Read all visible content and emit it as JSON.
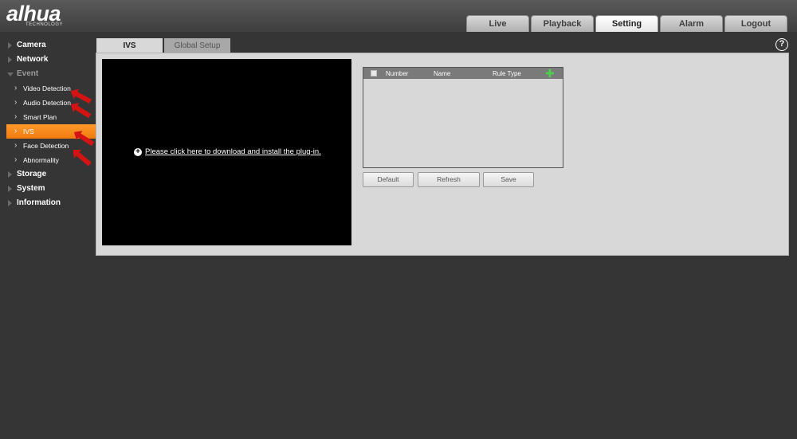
{
  "brand": {
    "logo_text": "alhua",
    "logo_sub": "TECHNOLOGY"
  },
  "nav": {
    "tabs": [
      {
        "label": "Live",
        "active": false
      },
      {
        "label": "Playback",
        "active": false
      },
      {
        "label": "Setting",
        "active": true
      },
      {
        "label": "Alarm",
        "active": false
      },
      {
        "label": "Logout",
        "active": false
      }
    ]
  },
  "sidebar": {
    "camera": "Camera",
    "network": "Network",
    "event": "Event",
    "event_items": [
      "Video Detection",
      "Audio Detection",
      "Smart Plan",
      "IVS",
      "Face Detection",
      "Abnormality"
    ],
    "active_item": "IVS",
    "storage": "Storage",
    "system": "System",
    "information": "Information"
  },
  "content": {
    "tabs": [
      "IVS",
      "Global Setup"
    ],
    "active_tab": "IVS",
    "help_glyph": "?",
    "plugin_message": "Please click here to download and install the plug-in.",
    "rule_table": {
      "columns": [
        "Number",
        "Name",
        "Rule Type"
      ],
      "rows": []
    },
    "buttons": {
      "default": "Default",
      "refresh": "Refresh",
      "save": "Save"
    }
  },
  "icons": {
    "help": "help-icon",
    "plus": "download-plus-icon",
    "add": "add-rule-icon"
  },
  "colors": {
    "active_menu": "#f5881a",
    "annotation_arrow": "#d41313",
    "add_icon": "#4cd04c"
  }
}
